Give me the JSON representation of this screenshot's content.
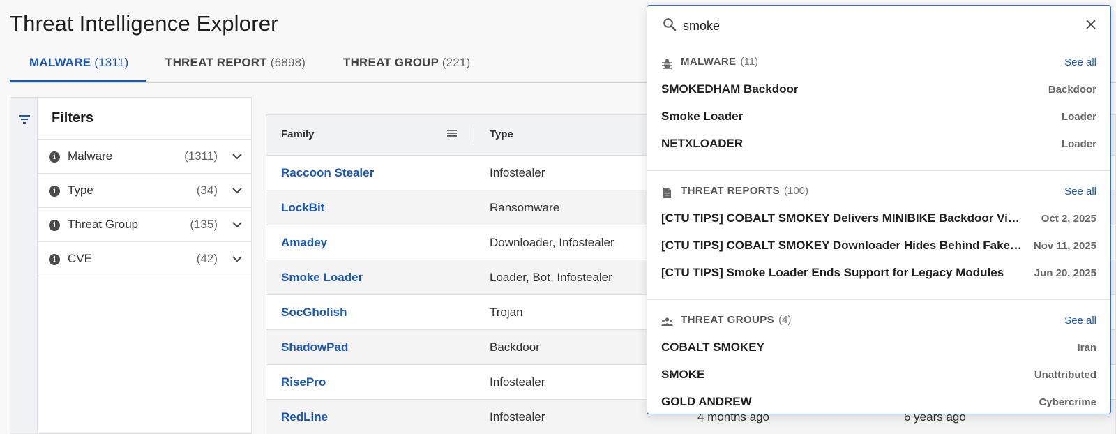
{
  "page": {
    "title": "Threat Intelligence Explorer"
  },
  "tabs": [
    {
      "label": "MALWARE",
      "count": "(1311)"
    },
    {
      "label": "THREAT REPORT",
      "count": "(6898)"
    },
    {
      "label": "THREAT GROUP",
      "count": "(221)"
    }
  ],
  "filters": {
    "title": "Filters",
    "items": [
      {
        "label": "Malware",
        "count": "(1311)"
      },
      {
        "label": "Type",
        "count": "(34)"
      },
      {
        "label": "Threat Group",
        "count": "(135)"
      },
      {
        "label": "CVE",
        "count": "(42)"
      }
    ]
  },
  "table": {
    "headers": {
      "family": "Family",
      "type": "Type"
    },
    "rows": [
      {
        "family": "Raccoon Stealer",
        "type": "Infostealer",
        "c3": "",
        "c4": ""
      },
      {
        "family": "LockBit",
        "type": "Ransomware",
        "c3": "",
        "c4": ""
      },
      {
        "family": "Amadey",
        "type": "Downloader, Infostealer",
        "c3": "",
        "c4": ""
      },
      {
        "family": "Smoke Loader",
        "type": "Loader, Bot, Infostealer",
        "c3": "",
        "c4": ""
      },
      {
        "family": "SocGholish",
        "type": "Trojan",
        "c3": "",
        "c4": ""
      },
      {
        "family": "ShadowPad",
        "type": "Backdoor",
        "c3": "",
        "c4": ""
      },
      {
        "family": "RisePro",
        "type": "Infostealer",
        "c3": "",
        "c4": ""
      },
      {
        "family": "RedLine",
        "type": "Infostealer",
        "c3": "4 months ago",
        "c4": "6 years ago"
      }
    ]
  },
  "search": {
    "value": "smoke",
    "sections": {
      "malware": {
        "title": "MALWARE",
        "count": "(11)",
        "see_all": "See all",
        "results": [
          {
            "name": "SMOKEDHAM Backdoor",
            "meta": "Backdoor"
          },
          {
            "name": "Smoke Loader",
            "meta": "Loader"
          },
          {
            "name": "NETXLOADER",
            "meta": "Loader"
          }
        ]
      },
      "reports": {
        "title": "THREAT REPORTS",
        "count": "(100)",
        "see_all": "See all",
        "results": [
          {
            "name": "[CTU TIPS] COBALT SMOKEY Delivers MINIBIKE Backdoor Via F...",
            "meta": "Oct 2, 2025"
          },
          {
            "name": "[CTU TIPS] COBALT SMOKEY Downloader Hides Behind Fake A...",
            "meta": "Nov 11, 2025"
          },
          {
            "name": "[CTU TIPS] Smoke Loader Ends Support for Legacy Modules",
            "meta": "Jun 20, 2025"
          }
        ]
      },
      "groups": {
        "title": "THREAT GROUPS",
        "count": "(4)",
        "see_all": "See all",
        "results": [
          {
            "name": "COBALT SMOKEY",
            "meta": "Iran"
          },
          {
            "name": "SMOKE",
            "meta": "Unattributed"
          },
          {
            "name": "GOLD ANDREW",
            "meta": "Cybercrime"
          }
        ]
      }
    }
  },
  "colors": {
    "accent": "#1b57b8",
    "focus_border": "#2f6dd0"
  }
}
